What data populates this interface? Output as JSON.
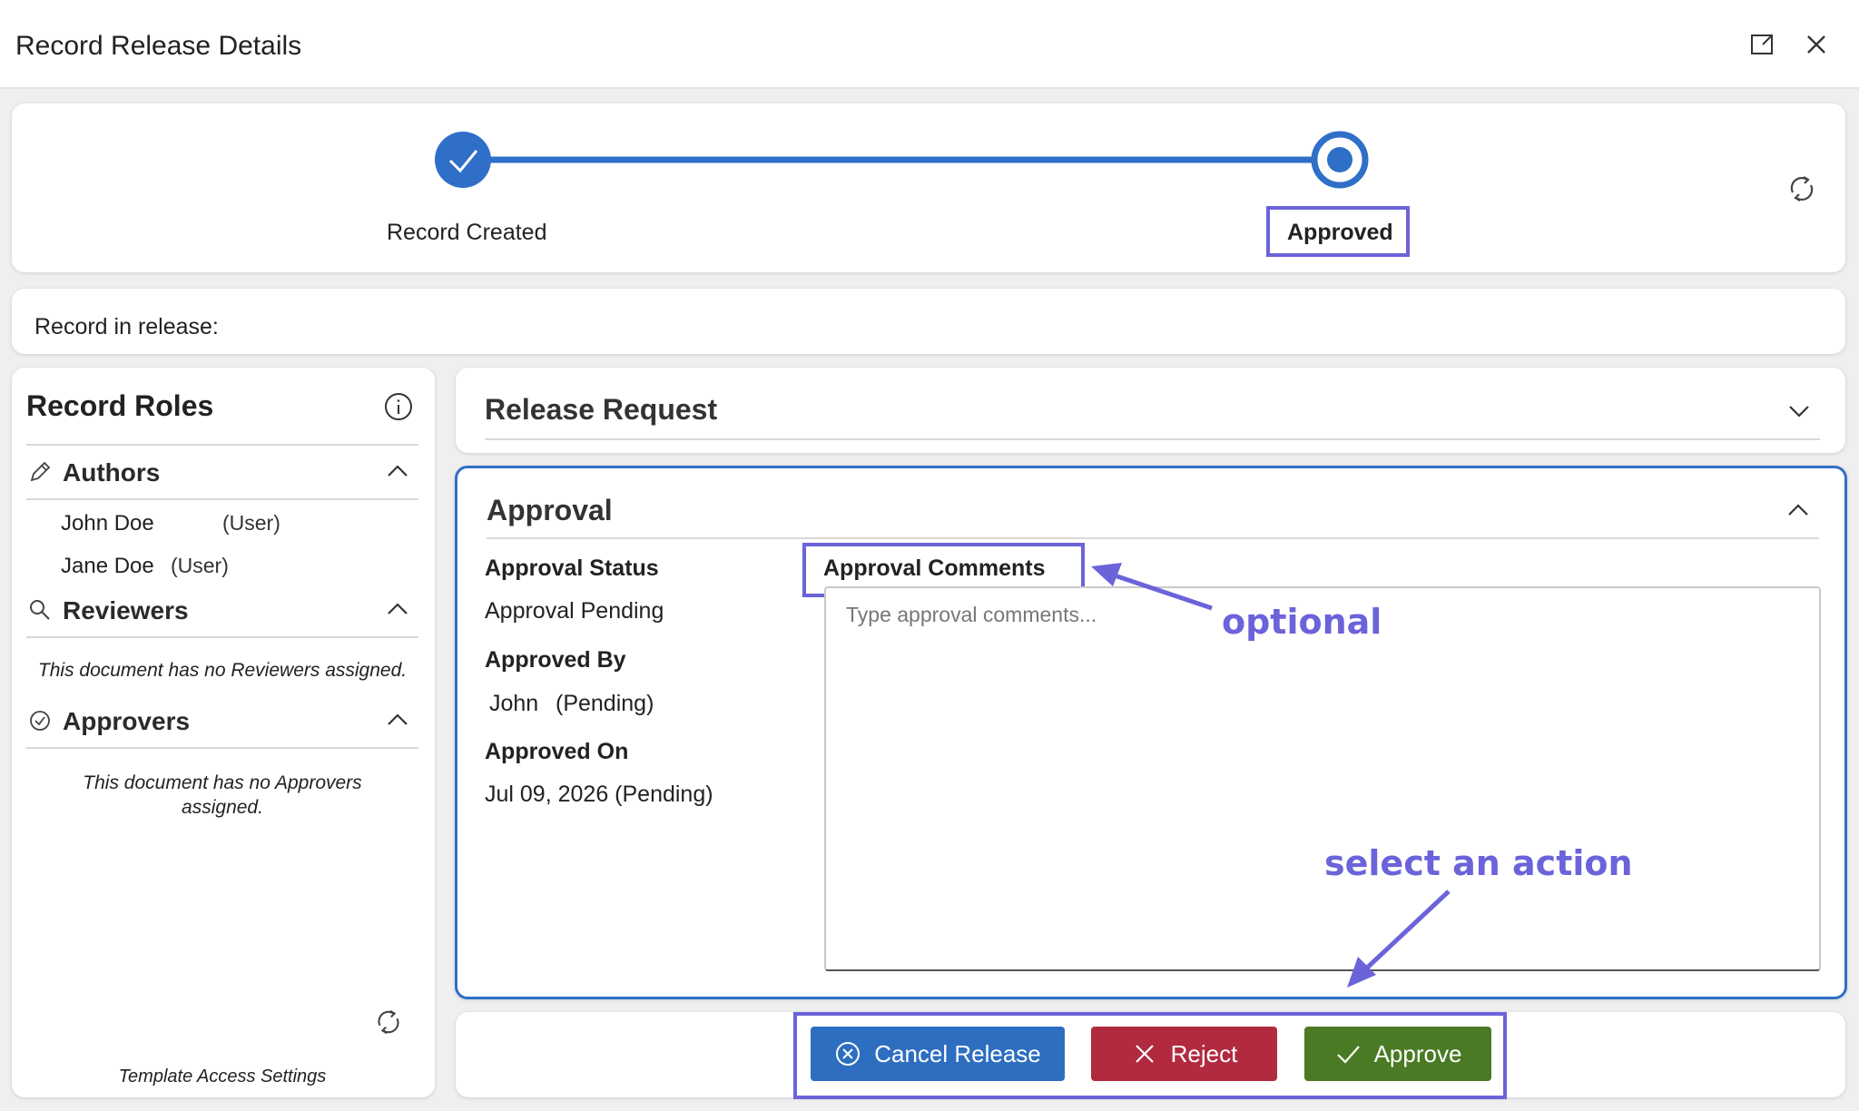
{
  "window": {
    "title": "Record Release Details",
    "icons": [
      "expand-icon",
      "close-icon"
    ]
  },
  "stepper": {
    "steps": [
      {
        "label": "Record Created",
        "state": "completed"
      },
      {
        "label": "Approved",
        "state": "current"
      }
    ],
    "refresh_icon": "refresh-icon"
  },
  "record_in_release": {
    "label": "Record in release:"
  },
  "record_roles": {
    "title": "Record Roles",
    "info_icon": "info-icon",
    "authors": {
      "label": "Authors",
      "icon": "pencil-icon",
      "people": [
        {
          "name": "John Doe",
          "role": "(User)"
        },
        {
          "name": "Jane Doe",
          "role": "(User)"
        }
      ]
    },
    "reviewers": {
      "label": "Reviewers",
      "icon": "search-icon",
      "empty_text": "This document has no Reviewers assigned."
    },
    "approvers": {
      "label": "Approvers",
      "icon": "check-circle-icon",
      "empty_text": "This document has no Approvers assigned."
    },
    "footer": "Template Access Settings"
  },
  "release_request": {
    "title": "Release Request",
    "expanded": false
  },
  "approval": {
    "title": "Approval",
    "expanded": true,
    "status_label": "Approval Status",
    "status_value": "Approval Pending",
    "approved_by_label": "Approved By",
    "approved_by_name": "John",
    "approved_by_state": "(Pending)",
    "approved_on_label": "Approved On",
    "approved_on_value": "Jul 09, 2026 (Pending)",
    "comments_label": "Approval Comments",
    "comments_placeholder": "Type approval comments...",
    "comments_value": ""
  },
  "actions": {
    "cancel_label": "Cancel Release",
    "reject_label": "Reject",
    "approve_label": "Approve"
  },
  "annotations": {
    "optional": "optional",
    "select_action": "select an action"
  },
  "colors": {
    "primary_blue": "#2f6fc7",
    "cancel_button": "#2d6ec1",
    "reject_button": "#b12a3f",
    "approve_button": "#4a7a24",
    "annotation": "#6b63d9"
  }
}
